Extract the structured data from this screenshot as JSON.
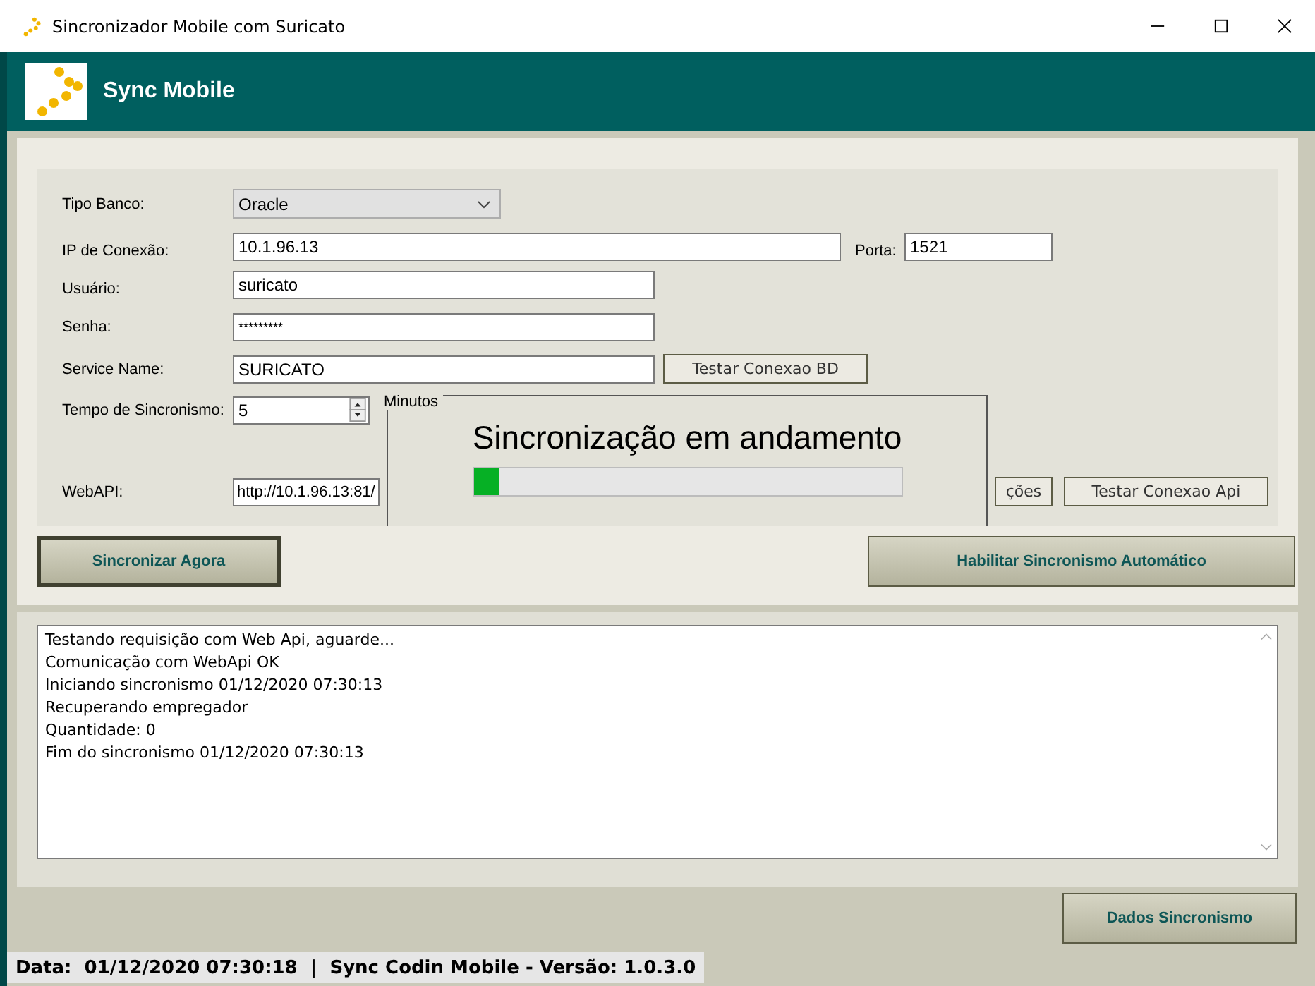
{
  "window": {
    "title": "Sincronizador Mobile com Suricato"
  },
  "header": {
    "title": "Sync Mobile"
  },
  "config": {
    "db_type": {
      "label": "Tipo Banco:",
      "value": "Oracle"
    },
    "ip": {
      "label": "IP de Conexão:",
      "value": "10.1.96.13"
    },
    "port": {
      "label": "Porta:",
      "value": "1521"
    },
    "user": {
      "label": "Usuário:",
      "value": "suricato"
    },
    "password": {
      "label": "Senha:",
      "value": "*********"
    },
    "service_name": {
      "label": "Service Name:",
      "value": "SURICATO"
    },
    "test_db_button": "Testar Conexao BD",
    "sync_interval": {
      "label": "Tempo de Sincronismo:",
      "value": "5",
      "unit": "Minutos"
    },
    "webapi": {
      "label": "WebAPI:",
      "value": "http://10.1.96.13:81/"
    },
    "api_buttons": [
      "ções",
      "Testar Conexao Api"
    ]
  },
  "progress_dialog": {
    "title": "Sincronização em andamento",
    "level": 0.06
  },
  "actions": [
    {
      "label": "Sincronizar Agora",
      "focused": true
    },
    {
      "label": "Habilitar Sincronismo Automático",
      "focused": false
    }
  ],
  "log": {
    "lines": [
      "Testando requisição com Web Api, aguarde...",
      "Comunicação com WebApi OK",
      "Iniciando sincronismo 01/12/2020 07:30:13",
      "Recuperando empregador",
      "Quantidade: 0",
      "Fim do sincronismo 01/12/2020 07:30:13"
    ]
  },
  "footer_button": "Dados Sincronismo",
  "status_bar": {
    "text": "Data:  01/12/2020 07:30:18  |  Sync Codin Mobile - Versão: 1.0.3.0"
  }
}
